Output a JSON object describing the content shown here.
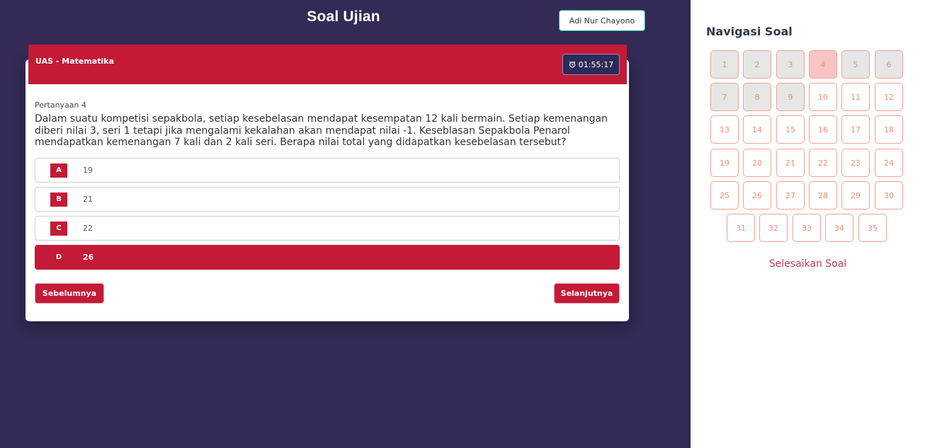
{
  "header": {
    "title": "Soal Ujian",
    "user_name": "Adi Nur Chayono"
  },
  "exam": {
    "title": "UAS - Matematika",
    "timer": "01:55:17",
    "timer_icon": "alarm-clock-icon"
  },
  "question": {
    "number_label": "Pertanyaan 4",
    "text": "Dalam suatu kompetisi sepakbola, setiap kesebelasan mendapat kesempatan 12 kali bermain. Setiap kemenangan diberi nilai 3, seri 1 tetapi jika mengalami kekalahan akan mendapat nilai -1. Keseblasan Sepakbola Penarol mendapatkan kemenangan 7 kali dan 2 kali seri. Berapa nilai total yang didapatkan kesebelasan tersebut?",
    "options": [
      {
        "letter": "A",
        "text": "19"
      },
      {
        "letter": "B",
        "text": "21"
      },
      {
        "letter": "C",
        "text": "22"
      },
      {
        "letter": "D",
        "text": "26"
      }
    ],
    "selected": "D"
  },
  "buttons": {
    "prev": "Sebelumnya",
    "next": "Selanjutnya"
  },
  "navigation": {
    "title": "Navigasi Soal",
    "items": [
      "1",
      "2",
      "3",
      "4",
      "5",
      "6",
      "7",
      "8",
      "9",
      "10",
      "11",
      "12",
      "13",
      "14",
      "15",
      "16",
      "17",
      "18",
      "19",
      "20",
      "21",
      "22",
      "23",
      "24",
      "25",
      "26",
      "27",
      "28",
      "29",
      "30",
      "31",
      "32",
      "33",
      "34",
      "35"
    ],
    "answered": [
      1,
      2,
      3,
      5,
      6,
      7,
      8,
      9
    ],
    "current": 4,
    "finish_label": "Selesaikan Soal"
  },
  "colors": {
    "primary": "#c41a36",
    "background": "#332a55",
    "nav_border": "#f2a18f",
    "nav_text": "#ee8e78",
    "timer_bg": "#2e2a57",
    "user_border": "#1ba99a"
  }
}
